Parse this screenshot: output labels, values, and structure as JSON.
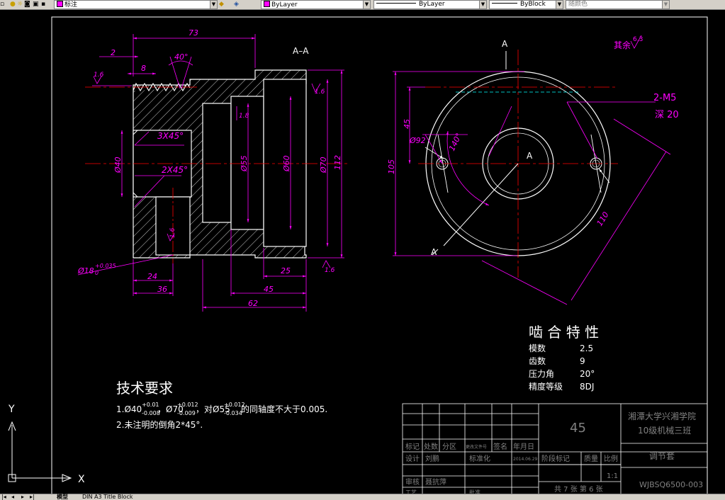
{
  "toolbar": {
    "layer_name": "标注",
    "color_control": "ByLayer",
    "linetype_control": "ByLayer",
    "lineweight_control": "ByBlock",
    "plotstyle_control": "随颜色"
  },
  "tabs": {
    "model": "模型",
    "layout": "DIN A3 Title Block"
  },
  "colors": {
    "background": "#000000",
    "outline": "#ffffff",
    "dimension": "#ff00ff",
    "centerline": "#ff0000",
    "hidden": "#00ffff"
  },
  "drawing": {
    "section_title": "A–A",
    "section_mark": "A",
    "section_mark_center": "A",
    "dims": {
      "d73": "73",
      "d2": "2",
      "d8": "8",
      "d40deg": "40°",
      "r16_top": "1.6",
      "r16_right": "1.6",
      "r18": "1.8",
      "r16_left": "1.6",
      "r16_bottom": "1.6",
      "ch3x45": "3X45°",
      "ch2x45": "2X45°",
      "phi40": "Ø40",
      "phi55": "Ø55",
      "phi60": "Ø60",
      "phi70": "Ø70",
      "d112": "112",
      "phi18": "Ø18",
      "phi18_tol_top": "+0.035",
      "phi18_tol_bot": "0",
      "d24": "24",
      "d36": "36",
      "d62": "62",
      "d45": "45",
      "d25": "25",
      "d105": "105",
      "d45_right": "45",
      "phi92": "Ø92",
      "deg140": "140°",
      "d110": "110",
      "m5_hole": "2-M5",
      "depth20": "深 20"
    },
    "roughness_other": "其余",
    "roughness_other_value": "6.3"
  },
  "gear": {
    "title": "啮 合 特 性",
    "rows": [
      {
        "label": "模数",
        "value": "2.5"
      },
      {
        "label": "齿数",
        "value": "9"
      },
      {
        "label": "压力角",
        "value": "20°"
      },
      {
        "label": "精度等级",
        "value": "8DJ"
      }
    ]
  },
  "tech": {
    "title": "技术要求",
    "line1_a": "1.Ø40",
    "line1_tol1_top": "+0.01",
    "line1_tol1_bot": "-0.008",
    "line1_b": "，Ø70",
    "line1_tol2_top": "+0.012",
    "line1_tol2_bot": "-0.009",
    "line1_c": "，对Ø55",
    "line1_tol3_top": "+0.012",
    "line1_tol3_bot": "-0.034",
    "line1_d": "的同轴度不大于0.005.",
    "line2": "2.未注明的倒角2*45°."
  },
  "titleblock": {
    "material": "45",
    "school": "湘潭大学兴湘学院",
    "class": "10级机械三班",
    "part_name": "调节套",
    "code": "WJBSQ6500-003",
    "h_mark": "标记",
    "h_count": "处数",
    "h_zone": "分区",
    "h_docno": "更改文件号",
    "h_sign": "签名",
    "h_date": "年月日",
    "r_design": "设计",
    "r_designer": "刘鹏",
    "r_std": "标准化",
    "r_std_date": "2014.06.29",
    "r_stage": "阶段标记",
    "r_weight": "质量",
    "r_scale": "比例",
    "scale_value": "1:1",
    "r_review": "审核",
    "r_reviewer": "聂抗萍",
    "r_craft": "工艺",
    "r_approve": "批准",
    "sheets": "共 7 张   第 6 张"
  },
  "ucs": {
    "x": "X",
    "y": "Y"
  }
}
